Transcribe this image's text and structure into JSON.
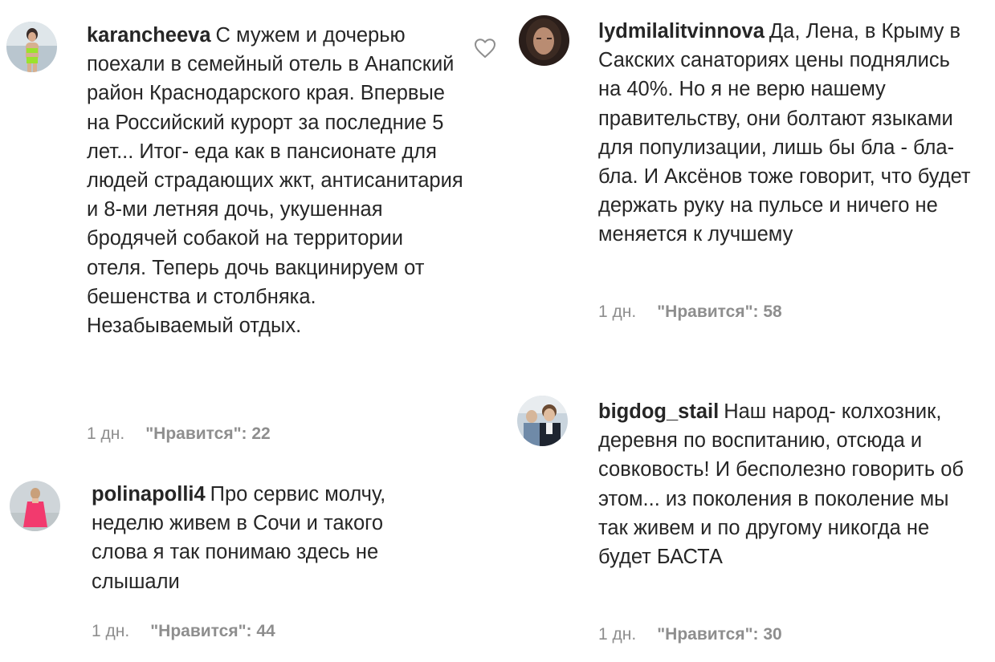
{
  "comments": [
    {
      "username": "karancheeva",
      "text": "С мужем и дочерью поехали в семейный отель в Анапский район Краснодарского края. Впервые на Российский курорт за последние 5 лет... Итог- еда как в пансионате для людей страдающих жкт, антисанитария и 8-ми летняя дочь, укушенная бродячей собакой на территории отеля. Теперь дочь вакцинируем от бешенства и столбняка. Незабываемый отдых.",
      "time": "1 дн.",
      "likes": "\"Нравится\": 22"
    },
    {
      "username": "polinapolli4",
      "text": "Про сервис молчу, неделю живем в Сочи и такого слова я так понимаю здесь не слышали",
      "time": "1 дн.",
      "likes": "\"Нравится\": 44"
    },
    {
      "username": "lydmilalitvinnova",
      "text": "Да, Лена, в Крыму в Сакских санаториях цены поднялись на 40%. Но я не верю нашему правительству, они болтают языками для популизации, лишь бы бла - бла-бла. И Аксёнов тоже говорит, что будет держать руку на пульсе и ничего не меняется к лучшему",
      "time": "1 дн.",
      "likes": "\"Нравится\": 58"
    },
    {
      "username": "bigdog_stail",
      "text": "Наш народ- колхозник, деревня по воспитанию, отсюда и совковость! И бесполезно говорить об этом... из поколения в поколение мы так живем и по другому никогда не будет БАСТА",
      "time": "1 дн.",
      "likes": "\"Нравится\": 30"
    }
  ],
  "icons": {
    "like": "heart-outline-icon"
  },
  "colors": {
    "text": "#262626",
    "meta": "#8e8e8e",
    "heart": "#8e8e8e"
  }
}
